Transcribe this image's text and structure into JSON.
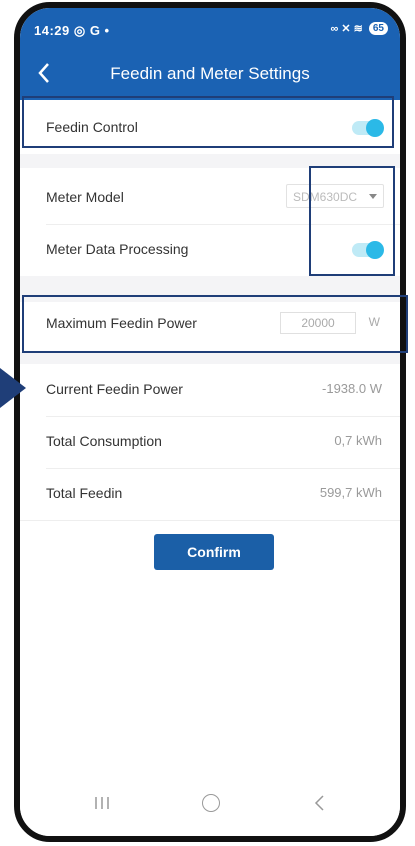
{
  "status_bar": {
    "time": "14:29",
    "icons_left": "◎ G •",
    "icons_right": "∞ ✕ ≋",
    "battery": "65"
  },
  "header": {
    "title": "Feedin and Meter Settings",
    "back_icon": "chevron-left-icon"
  },
  "feedin_control": {
    "label": "Feedin Control",
    "enabled": true
  },
  "meter_model": {
    "label": "Meter Model",
    "selected": "SDM630DC"
  },
  "meter_data_processing": {
    "label": "Meter Data Processing",
    "enabled": true
  },
  "max_feedin_power": {
    "label": "Maximum Feedin Power",
    "value": "20000",
    "unit": "W"
  },
  "readings": [
    {
      "label": "Current Feedin Power",
      "value": "-1938.0 W"
    },
    {
      "label": "Total Consumption",
      "value": "0,7 kWh"
    },
    {
      "label": "Total Feedin",
      "value": "599,7 kWh"
    }
  ],
  "confirm_label": "Confirm",
  "navbar": {
    "recent": "recent-apps-icon",
    "home": "home-icon",
    "back": "back-icon"
  },
  "colors": {
    "primary": "#1b62b3",
    "toggle_on": "#2bb9e7",
    "annotation": "#1f3e78"
  }
}
